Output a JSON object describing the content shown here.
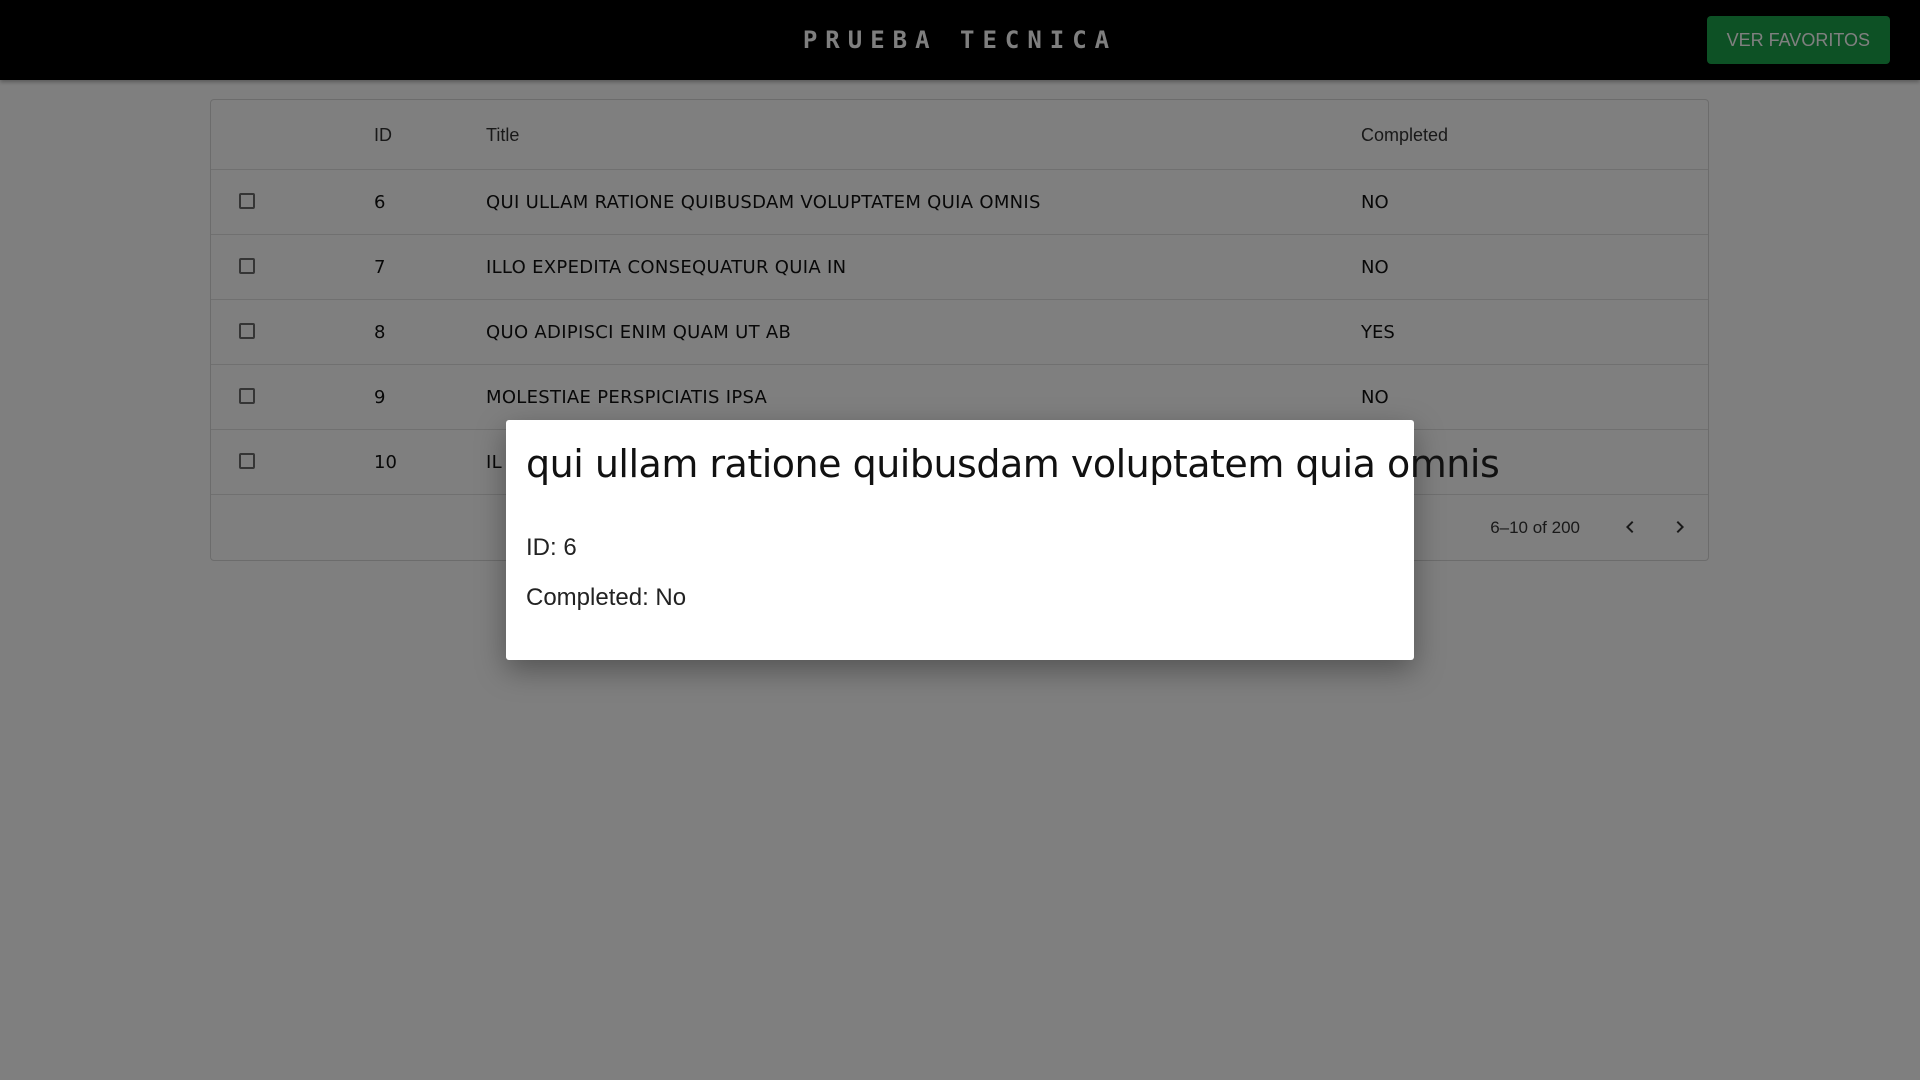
{
  "header": {
    "title": "PRUEBA TECNICA",
    "favorites_button": "VER FAVORITOS",
    "accent_color": "#1aa34a"
  },
  "table": {
    "columns": [
      "",
      "ID",
      "Title",
      "Completed"
    ],
    "rows": [
      {
        "checked": false,
        "id": "6",
        "title": "QUI ULLAM RATIONE QUIBUSDAM VOLUPTATEM QUIA OMNIS",
        "completed": "NO"
      },
      {
        "checked": false,
        "id": "7",
        "title": "ILLO EXPEDITA CONSEQUATUR QUIA IN",
        "completed": "NO"
      },
      {
        "checked": false,
        "id": "8",
        "title": "QUO ADIPISCI ENIM QUAM UT AB",
        "completed": "YES"
      },
      {
        "checked": false,
        "id": "9",
        "title": "MOLESTIAE PERSPICIATIS IPSA",
        "completed": "NO"
      },
      {
        "checked": false,
        "id": "10",
        "title": "IL",
        "completed": ""
      }
    ],
    "pagination": {
      "label": "6–10 of 200",
      "prev_icon": "chevron-left-icon",
      "next_icon": "chevron-right-icon"
    }
  },
  "modal": {
    "title": "qui ullam ratione quibusdam voluptatem quia omnis",
    "id_line": "ID: 6",
    "completed_line": "Completed: No"
  }
}
